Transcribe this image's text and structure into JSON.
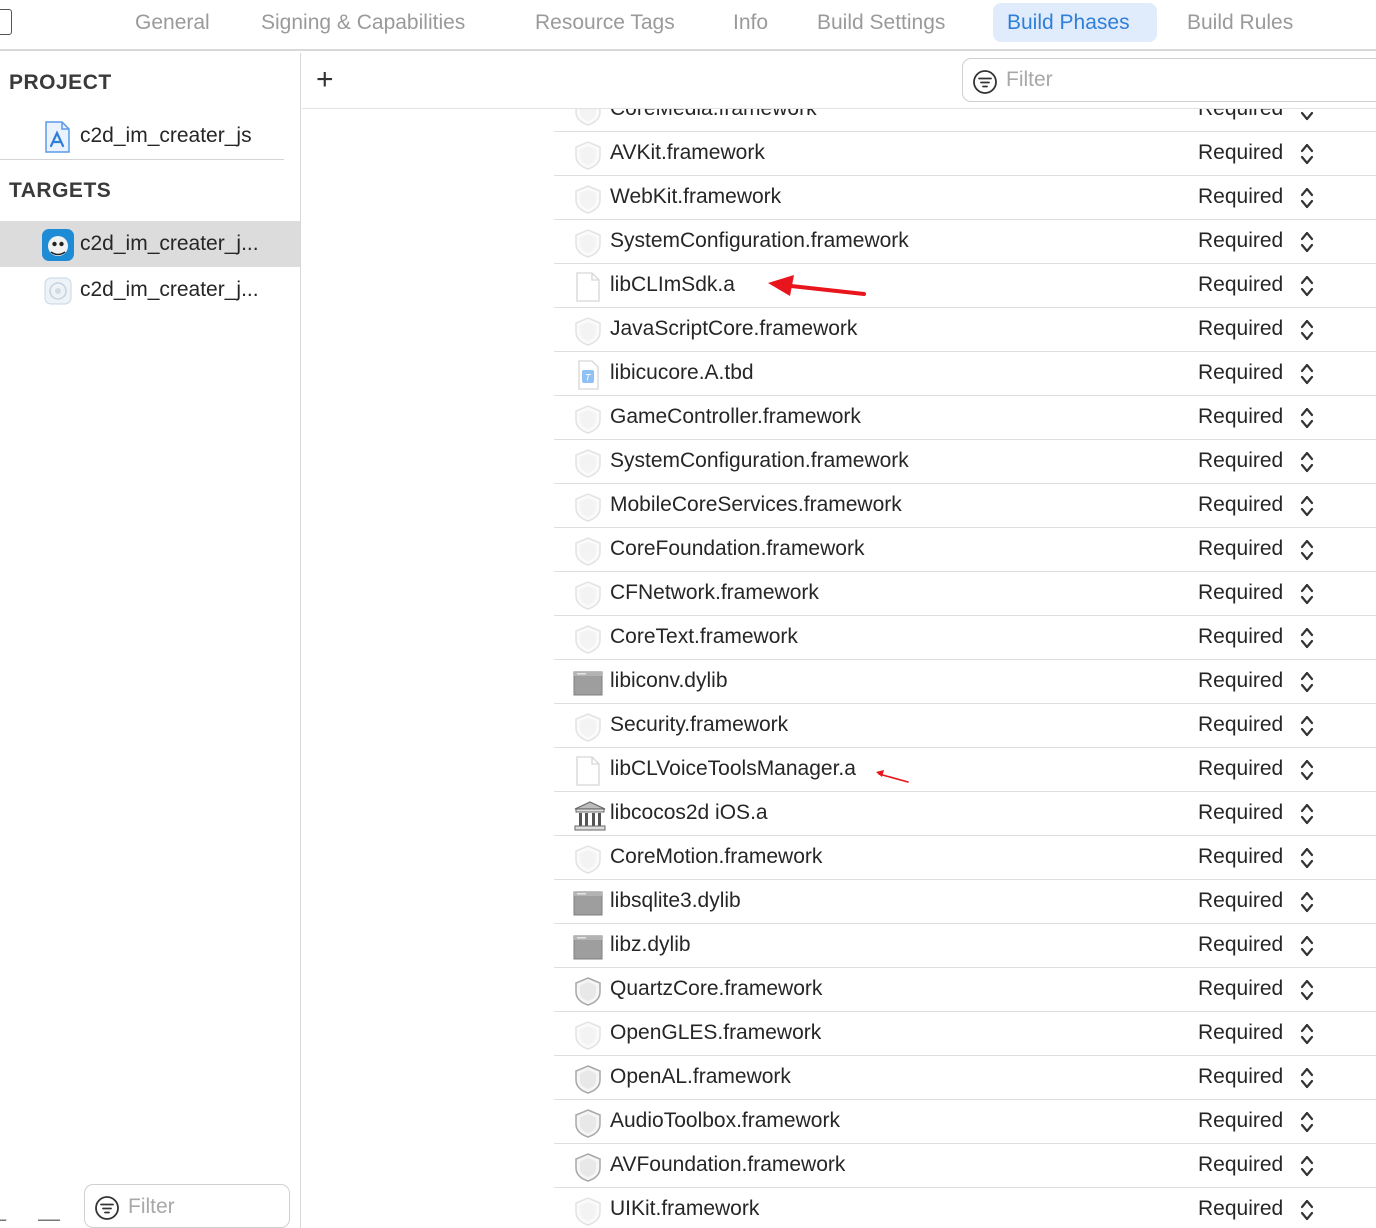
{
  "tabs": [
    {
      "label": "General",
      "active": false
    },
    {
      "label": "Signing & Capabilities",
      "active": false
    },
    {
      "label": "Resource Tags",
      "active": false
    },
    {
      "label": "Info",
      "active": false
    },
    {
      "label": "Build Settings",
      "active": false
    },
    {
      "label": "Build Phases",
      "active": true
    },
    {
      "label": "Build Rules",
      "active": false
    }
  ],
  "sidebar": {
    "project_title": "PROJECT",
    "project_item": "c2d_im_creater_js",
    "targets_title": "TARGETS",
    "targets": [
      {
        "label": "c2d_im_creater_j...",
        "selected": true
      },
      {
        "label": "c2d_im_creater_j...",
        "selected": false
      }
    ],
    "filter_placeholder": "Filter"
  },
  "toolbar": {
    "add_label": "+",
    "filter_placeholder": "Filter"
  },
  "libraries": [
    {
      "name": "CoreMedia.framework",
      "status": "Required",
      "icon": "framework-icon"
    },
    {
      "name": "AVKit.framework",
      "status": "Required",
      "icon": "framework-icon"
    },
    {
      "name": "WebKit.framework",
      "status": "Required",
      "icon": "framework-icon"
    },
    {
      "name": "SystemConfiguration.framework",
      "status": "Required",
      "icon": "framework-icon"
    },
    {
      "name": "libCLImSdk.a",
      "status": "Required",
      "icon": "file-icon"
    },
    {
      "name": "JavaScriptCore.framework",
      "status": "Required",
      "icon": "framework-icon"
    },
    {
      "name": "libicucore.A.tbd",
      "status": "Required",
      "icon": "tbd-file-icon"
    },
    {
      "name": "GameController.framework",
      "status": "Required",
      "icon": "framework-icon"
    },
    {
      "name": "SystemConfiguration.framework",
      "status": "Required",
      "icon": "framework-icon"
    },
    {
      "name": "MobileCoreServices.framework",
      "status": "Required",
      "icon": "framework-icon"
    },
    {
      "name": "CoreFoundation.framework",
      "status": "Required",
      "icon": "framework-icon"
    },
    {
      "name": "CFNetwork.framework",
      "status": "Required",
      "icon": "framework-icon"
    },
    {
      "name": "CoreText.framework",
      "status": "Required",
      "icon": "framework-icon"
    },
    {
      "name": "libiconv.dylib",
      "status": "Required",
      "icon": "dylib-icon"
    },
    {
      "name": "Security.framework",
      "status": "Required",
      "icon": "framework-icon"
    },
    {
      "name": "libCLVoiceToolsManager.a",
      "status": "Required",
      "icon": "file-icon"
    },
    {
      "name": "libcocos2d iOS.a",
      "status": "Required",
      "icon": "library-icon"
    },
    {
      "name": "CoreMotion.framework",
      "status": "Required",
      "icon": "framework-icon"
    },
    {
      "name": "libsqlite3.dylib",
      "status": "Required",
      "icon": "dylib-icon"
    },
    {
      "name": "libz.dylib",
      "status": "Required",
      "icon": "dylib-icon"
    },
    {
      "name": "QuartzCore.framework",
      "status": "Required",
      "icon": "framework-dark-icon"
    },
    {
      "name": "OpenGLES.framework",
      "status": "Required",
      "icon": "framework-icon"
    },
    {
      "name": "OpenAL.framework",
      "status": "Required",
      "icon": "framework-dark-icon"
    },
    {
      "name": "AudioToolbox.framework",
      "status": "Required",
      "icon": "framework-dark-icon"
    },
    {
      "name": "AVFoundation.framework",
      "status": "Required",
      "icon": "framework-dark-icon"
    },
    {
      "name": "UIKit.framework",
      "status": "Required",
      "icon": "framework-icon"
    }
  ],
  "colors": {
    "accent": "#2f7fd8",
    "active_tab_bg": "#e0ecfb",
    "annotation_arrow": "#e8161c"
  }
}
